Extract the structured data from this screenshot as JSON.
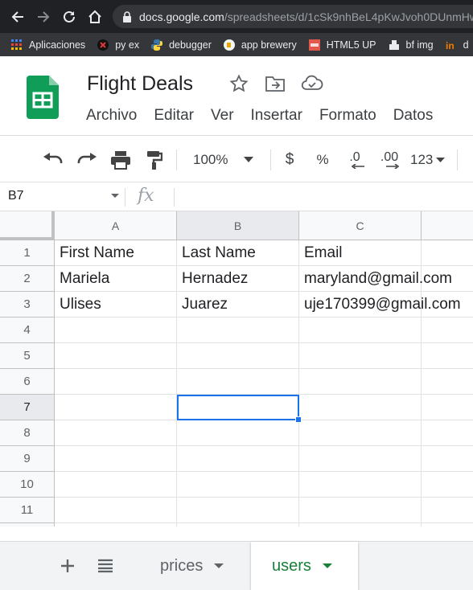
{
  "browser": {
    "url_host": "docs.google.com",
    "url_path": "/spreadsheets/d/1cSk9nhBeL4pKwJvoh0DUnmHw"
  },
  "bookmarks": [
    {
      "label": "Aplicaciones",
      "icon": "apps-grid-icon"
    },
    {
      "label": "py ex",
      "icon": "red-x-icon"
    },
    {
      "label": "debugger",
      "icon": "python-icon"
    },
    {
      "label": "app brewery",
      "icon": "brewery-icon"
    },
    {
      "label": "HTML5 UP",
      "icon": "html5up-icon"
    },
    {
      "label": "bf img",
      "icon": "bf-img-icon"
    },
    {
      "label": "d",
      "icon": "orange-in-icon"
    }
  ],
  "doc": {
    "title": "Flight Deals"
  },
  "menu": [
    "Archivo",
    "Editar",
    "Ver",
    "Insertar",
    "Formato",
    "Datos"
  ],
  "toolbar": {
    "zoom": "100%",
    "currency": "$",
    "percent": "%",
    "dec_decrease": ".0",
    "dec_increase": ".00",
    "format": "123"
  },
  "formula_bar": {
    "name_box": "B7",
    "fx": "fx",
    "value": ""
  },
  "grid": {
    "columns": [
      "A",
      "B",
      "C"
    ],
    "rows": [
      "1",
      "2",
      "3",
      "4",
      "5",
      "6",
      "7",
      "8",
      "9",
      "10",
      "11"
    ],
    "cells": [
      [
        "First Name",
        "Last Name",
        "Email"
      ],
      [
        "Mariela",
        "Hernadez",
        "maryland@gmail.com"
      ],
      [
        "Ulises",
        "Juarez",
        "uje170399@gmail.com"
      ]
    ],
    "selected_cell": "B7"
  },
  "sheet_tabs": [
    {
      "label": "prices",
      "active": false
    },
    {
      "label": "users",
      "active": true
    }
  ],
  "colors": {
    "sheets_green": "#188038",
    "selection_blue": "#1a73e8",
    "chrome_dark": "#202124"
  }
}
